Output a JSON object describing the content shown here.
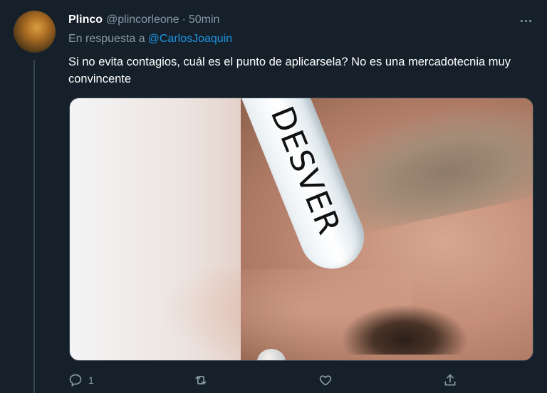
{
  "tweet": {
    "display_name": "Plinco",
    "handle": "@plincorleone",
    "separator": "·",
    "time": "50min",
    "reply_prefix": "En respuesta a",
    "reply_to": "@CarlosJoaquin",
    "text": "Si no evita contagios, cuál es el punto de aplicarsela? No es una mercadotecnia muy convincente",
    "media": {
      "dropper_label": "DESVER"
    },
    "actions": {
      "reply_count": "1",
      "retweet_count": "",
      "like_count": ""
    }
  },
  "colors": {
    "background": "#15202b",
    "secondary_text": "#8899a6",
    "link": "#1b95e0",
    "thread_line": "#38444d"
  },
  "icons": [
    "more-icon",
    "reply-icon",
    "retweet-icon",
    "like-icon",
    "share-icon"
  ]
}
